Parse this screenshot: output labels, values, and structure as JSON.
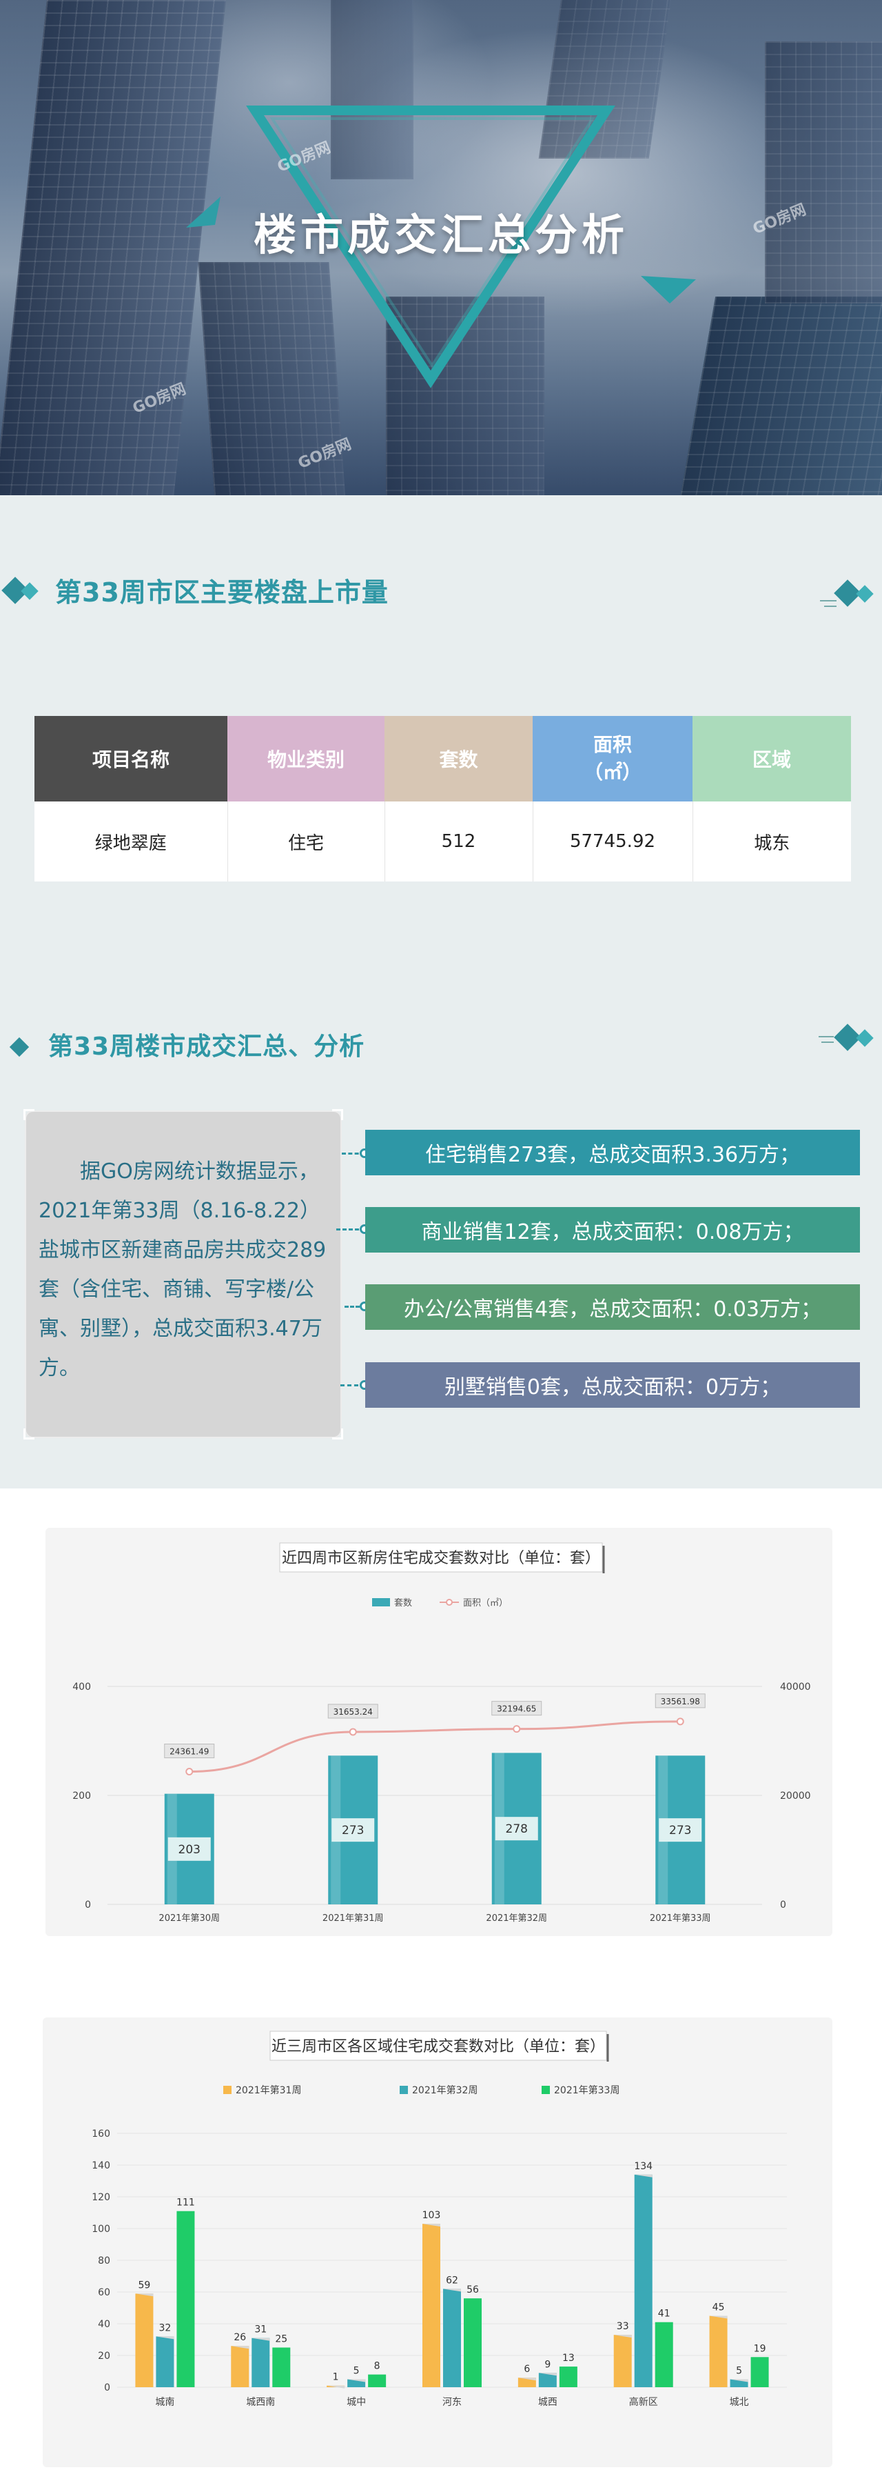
{
  "hero": {
    "title": "楼市成交汇总分析",
    "watermark": "GO房网"
  },
  "section1": {
    "title": "第33周市区主要楼盘上市量"
  },
  "table": {
    "headers": [
      "项目名称",
      "物业类别",
      "套数",
      "面积\n（㎡）",
      "区域"
    ],
    "header_colors": [
      "#4d4d4d",
      "#d8b5cf",
      "#d7c6b4",
      "#79addf",
      "#abdbbb"
    ],
    "rows": [
      [
        "绿地翠庭",
        "住宅",
        "512",
        "57745.92",
        "城东"
      ]
    ]
  },
  "section2": {
    "title": "第33周楼市成交汇总、分析"
  },
  "summary": "据GO房网统计数据显示，2021年第33周（8.16-8.22）盐城市区新建商品房共成交289套（含住宅、商铺、写字楼/公寓、别墅），总成交面积3.47万方。",
  "pills": [
    {
      "text": "住宅销售273套，总成交面积3.36万方；",
      "color": "#2e97a6"
    },
    {
      "text": "商业销售12套，总成交面积：0.08万方；",
      "color": "#3d9d8b"
    },
    {
      "text": "办公/公寓销售4套，总成交面积：0.03万方；",
      "color": "#5a9d74"
    },
    {
      "text": "别墅销售0套，总成交面积：0万方；",
      "color": "#6c7c9e"
    }
  ],
  "chart_data": [
    {
      "type": "bar",
      "title": "近四周市区新房住宅成交套数对比（单位：套）",
      "categories": [
        "2021年第30周",
        "2021年第31周",
        "2021年第32周",
        "2021年第33周"
      ],
      "series": [
        {
          "name": "套数",
          "kind": "bar",
          "axis": "left",
          "values": [
            203,
            273,
            278,
            273
          ],
          "color": "#3aa9b6"
        },
        {
          "name": "面积（㎡）",
          "kind": "line",
          "axis": "right",
          "values": [
            24361.49,
            31653.24,
            32194.65,
            33561.98
          ],
          "color": "#eaa5a1"
        }
      ],
      "ylim_left": [
        0,
        400
      ],
      "yticks_left": [
        0,
        200,
        400
      ],
      "ylim_right": [
        0,
        40000
      ],
      "yticks_right": [
        0,
        20000,
        40000
      ],
      "legend": "top-center",
      "grid": true
    },
    {
      "type": "bar",
      "title": "近三周市区各区域住宅成交套数对比（单位：套）",
      "categories": [
        "城南",
        "城西南",
        "城中",
        "河东",
        "城西",
        "高新区",
        "城北"
      ],
      "series": [
        {
          "name": "2021年第31周",
          "values": [
            59,
            26,
            1,
            103,
            6,
            33,
            45
          ],
          "color": "#f7b84b"
        },
        {
          "name": "2021年第32周",
          "values": [
            32,
            31,
            5,
            62,
            9,
            134,
            5
          ],
          "color": "#3aa9b6"
        },
        {
          "name": "2021年第33周",
          "values": [
            111,
            25,
            8,
            56,
            13,
            41,
            19
          ],
          "color": "#1fcc68"
        }
      ],
      "ylim": [
        0,
        160
      ],
      "yticks": [
        0,
        20,
        40,
        60,
        80,
        100,
        120,
        140,
        160
      ],
      "legend": "top-center",
      "grid": true
    }
  ]
}
